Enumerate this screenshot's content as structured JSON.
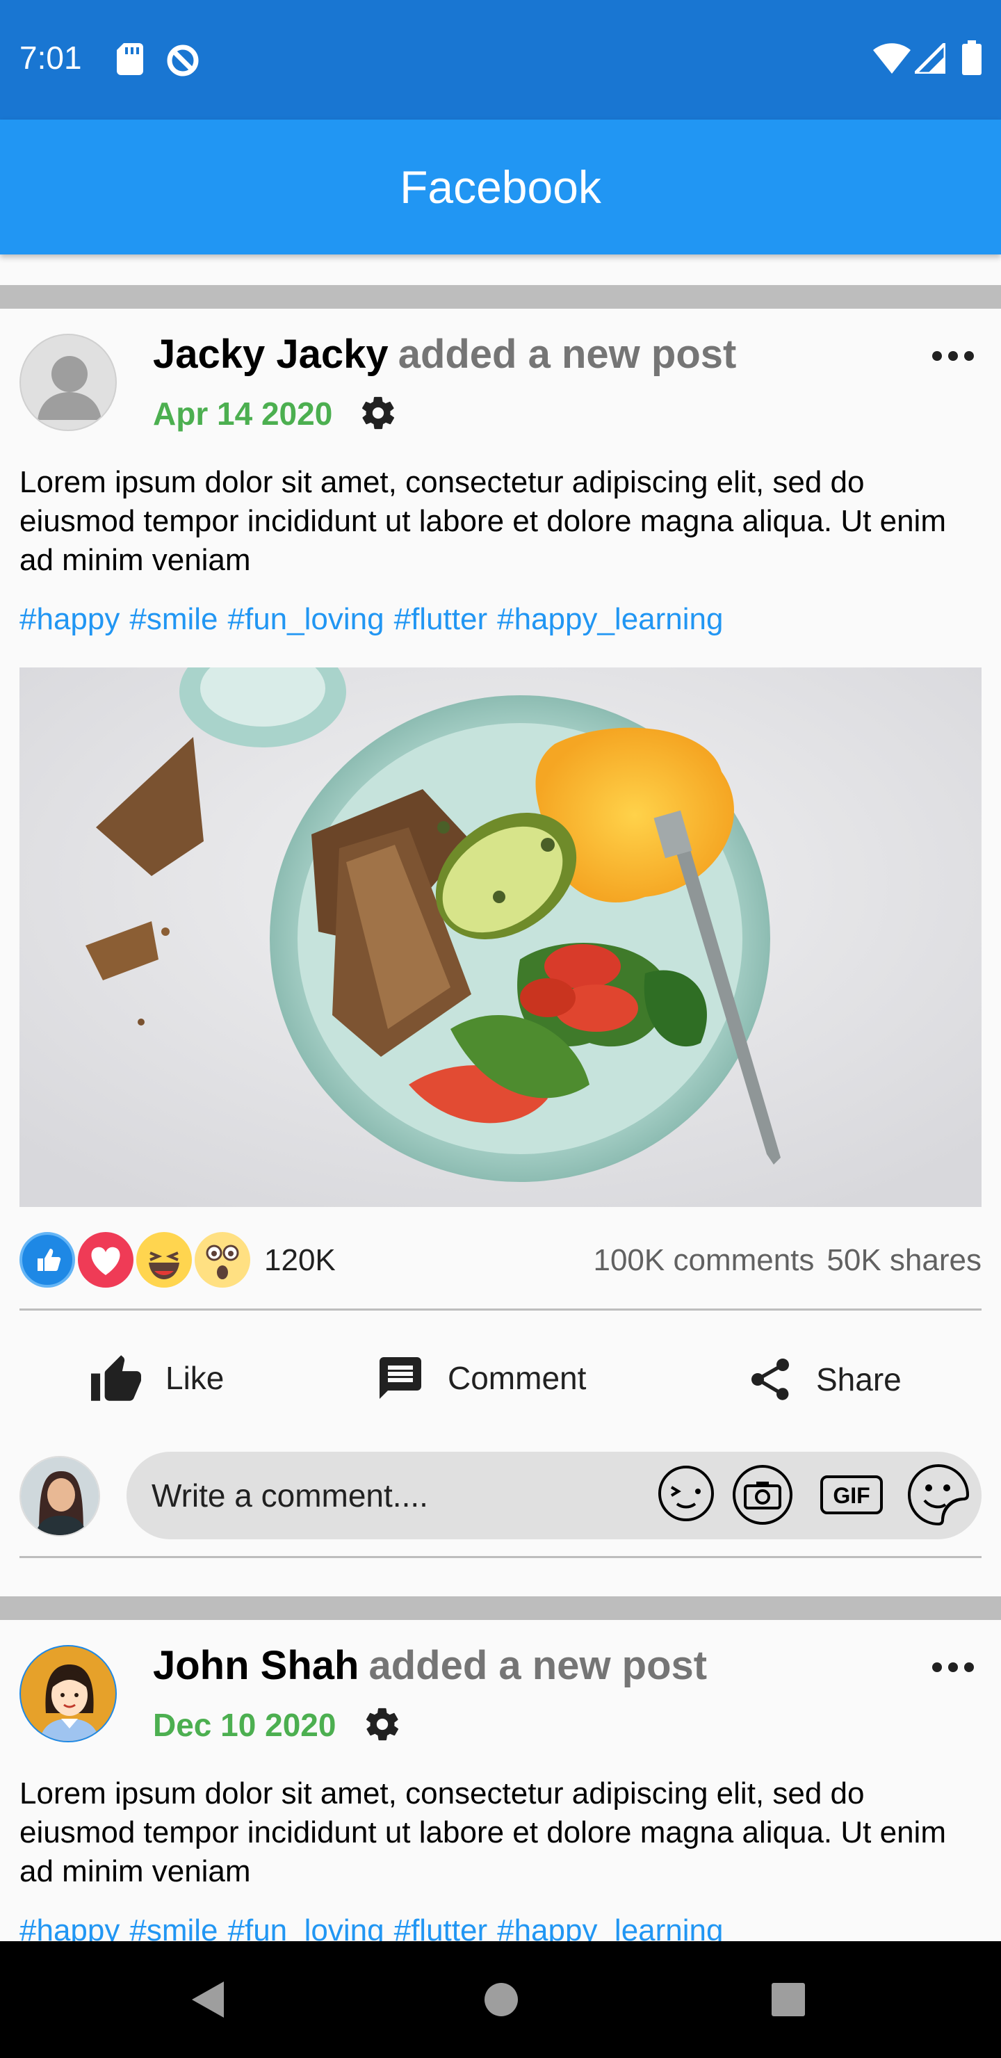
{
  "status_bar": {
    "time": "7:01"
  },
  "app_bar": {
    "title": "Facebook"
  },
  "posts": [
    {
      "author": "Jacky Jacky",
      "action": "added a new post",
      "date": "Apr 14 2020",
      "text": "Lorem ipsum dolor sit amet, consectetur adipiscing elit, sed do eiusmod tempor incididunt ut labore et dolore magna aliqua. Ut enim ad minim veniam",
      "tags": [
        "#happy",
        "#smile",
        "#fun_loving",
        "#flutter",
        "#happy_learning"
      ],
      "reaction_count": "120K",
      "comments": "100K comments",
      "shares": "50K shares",
      "actions": {
        "like": "Like",
        "comment": "Comment",
        "share": "Share"
      },
      "comment_placeholder": "Write a comment...."
    },
    {
      "author": "John Shah",
      "action": "added a new post",
      "date": "Dec 10 2020",
      "text": "Lorem ipsum dolor sit amet, consectetur adipiscing elit, sed do eiusmod tempor incididunt ut labore et dolore magna aliqua. Ut enim ad minim veniam",
      "tags": [
        "#happy",
        "#smile",
        "#fun_loving",
        "#flutter",
        "#happy_learning"
      ]
    }
  ],
  "colors": {
    "app_bar": "#2196f3",
    "status_bar": "#1976d2",
    "date": "#4caf50",
    "hashtag": "#2196f3"
  }
}
